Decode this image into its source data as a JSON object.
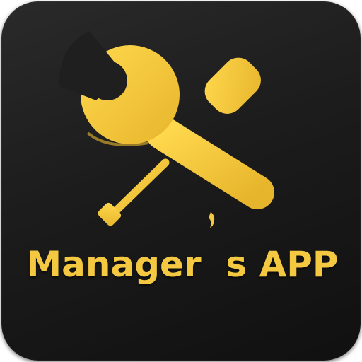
{
  "app_icon": {
    "label": "Manager  s APP",
    "tools_icon": "wrench-and-screwdriver-icon",
    "colors": {
      "accent": "#F5C842",
      "accent_dark": "#C99A1A",
      "background": "#1C1C1C"
    }
  }
}
